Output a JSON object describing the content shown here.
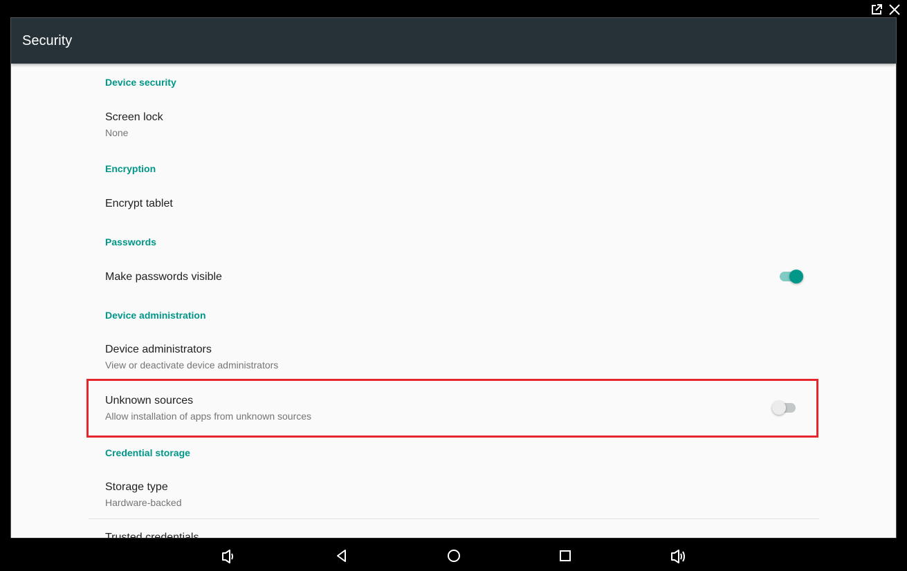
{
  "window": {
    "icons": [
      "external-link-icon",
      "close-icon"
    ]
  },
  "appbar": {
    "title": "Security"
  },
  "sections": [
    {
      "category": "Device security",
      "items": [
        {
          "title": "Screen lock",
          "summary": "None"
        }
      ]
    },
    {
      "category": "Encryption",
      "items": [
        {
          "title": "Encrypt tablet",
          "summary": ""
        }
      ]
    },
    {
      "category": "Passwords",
      "items": [
        {
          "title": "Make passwords visible",
          "summary": "",
          "toggle": true,
          "checked": true
        }
      ]
    },
    {
      "category": "Device administration",
      "items": [
        {
          "title": "Device administrators",
          "summary": "View or deactivate device administrators"
        },
        {
          "title": "Unknown sources",
          "summary": "Allow installation of apps from unknown sources",
          "toggle": true,
          "checked": false,
          "highlighted": true
        }
      ]
    },
    {
      "category": "Credential storage",
      "items": [
        {
          "title": "Storage type",
          "summary": "Hardware-backed"
        },
        {
          "title": "Trusted credentials",
          "summary": ""
        }
      ]
    }
  ],
  "colors": {
    "accent": "#009688",
    "appbar": "#263238",
    "highlight": "#e6262e"
  },
  "navbar": {
    "buttons": [
      "volume-down",
      "back",
      "home",
      "recents",
      "volume-up"
    ]
  }
}
